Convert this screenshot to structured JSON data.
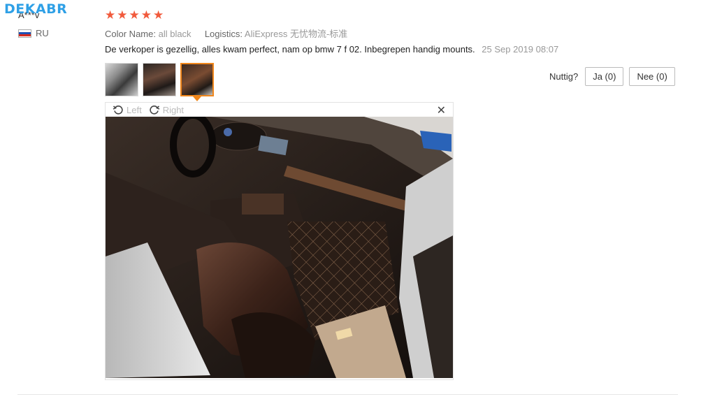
{
  "watermark": "DEKABR",
  "reviewer": {
    "name": "A***v",
    "country": "RU"
  },
  "rating": {
    "stars": 5
  },
  "meta": {
    "color_label": "Color Name:",
    "color_value": "all black",
    "logistics_label": "Logistics:",
    "logistics_value": "AliExpress 无忧物流-标准"
  },
  "review": {
    "text": "De verkoper is gezellig, alles kwam perfect, nam op bmw 7 f 02. Inbegrepen handig mounts.",
    "date": "25 Sep 2019 08:07"
  },
  "helpful": {
    "label": "Nuttig?",
    "yes": "Ja (0)",
    "no": "Nee (0)"
  },
  "viewer": {
    "left_label": "Left",
    "right_label": "Right",
    "close_icon": "close-icon"
  },
  "colors": {
    "star": "#f15a3c",
    "active_border": "#f0871c",
    "watermark": "#2fa0e6"
  }
}
